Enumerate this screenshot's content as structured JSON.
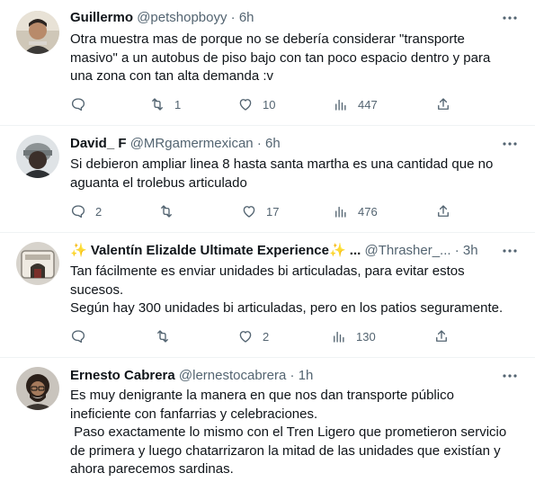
{
  "tweets": [
    {
      "name": "Guillermo",
      "handle": "@petshopboyy",
      "time": "6h",
      "lines": [
        "Otra muestra mas de porque no se debería considerar \"transporte",
        "masivo\" a un autobus de piso bajo con tan poco espacio dentro y para",
        "una zona con tan alta demanda :v"
      ],
      "replies": "",
      "retweets": "1",
      "likes": "10",
      "views": "447"
    },
    {
      "name": "David_ F",
      "handle": "@MRgamermexican",
      "time": "6h",
      "lines": [
        "Si debieron ampliar linea 8 hasta santa martha es una cantidad que no",
        "aguanta el trolebus articulado"
      ],
      "replies": "2",
      "retweets": "",
      "likes": "17",
      "views": "476"
    },
    {
      "name": "✨ Valentín Elizalde Ultimate Experience✨ ...",
      "handle": "@Thrasher_...",
      "time": "3h",
      "lines": [
        "Tan fácilmente es enviar unidades bi articuladas, para evitar estos",
        "sucesos.",
        "Según hay 300 unidades bi articuladas, pero en los patios seguramente."
      ],
      "replies": "",
      "retweets": "",
      "likes": "2",
      "views": "130"
    },
    {
      "name": "Ernesto Cabrera",
      "handle": "@lernestocabrera",
      "time": "1h",
      "lines": [
        "Es muy denigrante la manera en que nos dan transporte público",
        "ineficiente con fanfarrias y celebraciones.",
        " Paso exactamente lo mismo con el Tren Ligero que prometieron servicio",
        "de primera y luego chatarrizaron la mitad de las unidades que existían y",
        "ahora parecemos sardinas."
      ],
      "replies": "",
      "retweets": "",
      "likes": "",
      "views": ""
    }
  ],
  "separator": "·",
  "icons": {
    "more": "more-horizontal-icon",
    "reply": "reply-icon",
    "retweet": "retweet-icon",
    "like": "like-icon",
    "views": "views-icon",
    "share": "share-icon"
  },
  "colors": {
    "text": "#0f1419",
    "secondary": "#536471",
    "divider": "#eff3f4"
  }
}
